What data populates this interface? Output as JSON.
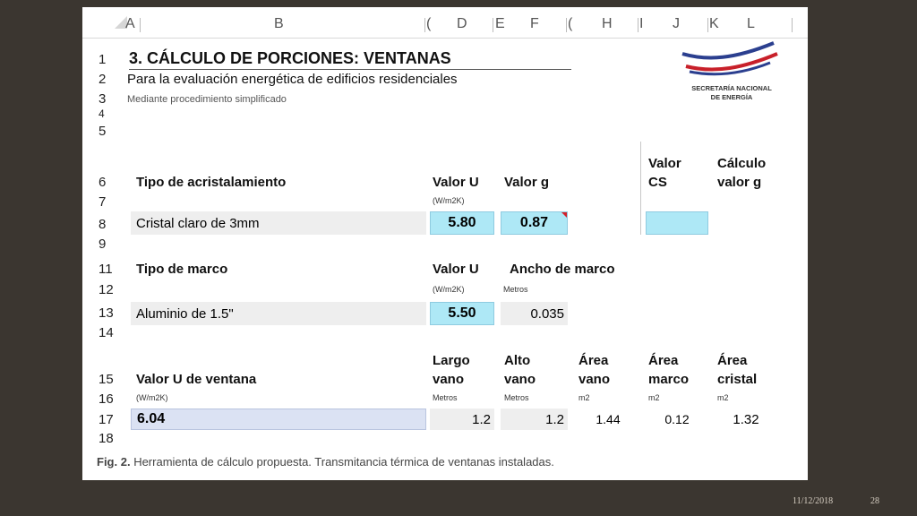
{
  "columns": [
    "A",
    "B",
    "(",
    "D",
    "E",
    "F",
    "(",
    "H",
    "I",
    "J",
    "K",
    "L"
  ],
  "rows": [
    "1",
    "2",
    "3",
    "4",
    "5",
    "6",
    "7",
    "8",
    "9",
    "11",
    "12",
    "13",
    "14",
    "15",
    "16",
    "17",
    "18"
  ],
  "title": "3. CÁLCULO DE PORCIONES: VENTANAS",
  "subtitle": "Para la evaluación energética de edificios residenciales",
  "subtitle2": "Mediante procedimiento simplificado",
  "logo": {
    "line1": "SECRETARÍA NACIONAL",
    "line2": "DE ENERGÍA"
  },
  "glazing": {
    "label": "Tipo de acristalamiento",
    "u_header": "Valor U",
    "u_unit": "(W/m2K)",
    "g_header": "Valor g",
    "cs_header_1": "Valor",
    "cs_header_2": "CS",
    "calc_header_1": "Cálculo",
    "calc_header_2": "valor g",
    "value": "Cristal claro de 3mm",
    "u_value": "5.80",
    "g_value": "0.87"
  },
  "frame": {
    "label": "Tipo de marco",
    "u_header": "Valor U",
    "u_unit": "(W/m2K)",
    "width_header": "Ancho de marco",
    "width_unit": "Metros",
    "value": "Aluminio de 1.5\"",
    "u_value": "5.50",
    "width_value": "0.035"
  },
  "window": {
    "label": "Valor U de ventana",
    "label_unit": "(W/m2K)",
    "h1": [
      "Largo",
      "vano"
    ],
    "h2": [
      "Alto",
      "vano"
    ],
    "h3": [
      "Área",
      "vano"
    ],
    "h4": [
      "Área",
      "marco"
    ],
    "h5": [
      "Área",
      "cristal"
    ],
    "u1": "Metros",
    "u2": "Metros",
    "u3": "m2",
    "u4": "m2",
    "u5": "m2",
    "u_value": "6.04",
    "largo": "1.2",
    "alto": "1.2",
    "area_vano": "1.44",
    "area_marco": "0.12",
    "area_cristal": "1.32"
  },
  "caption": {
    "fig": "Fig. 2.",
    "text": "Herramienta de cálculo propuesta. Transmitancia térmica de ventanas instaladas."
  },
  "footer": {
    "date": "11/12/2018",
    "page": "28"
  }
}
